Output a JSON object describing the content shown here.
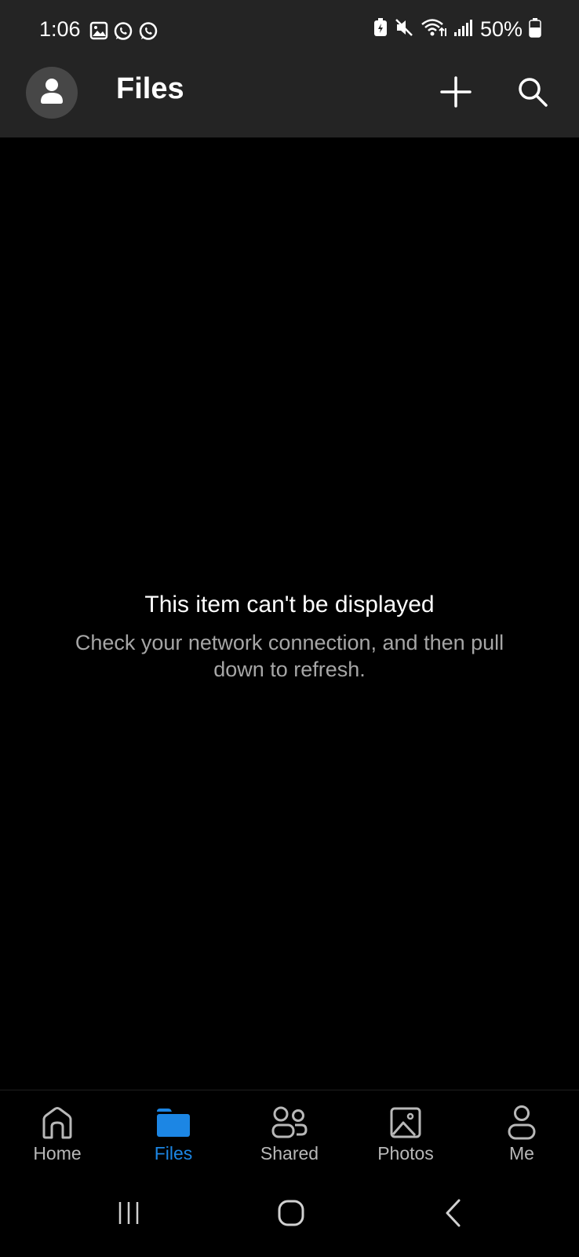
{
  "status_bar": {
    "time": "1:06",
    "battery": "50%",
    "left_icons": [
      "gallery-notification-icon",
      "whatsapp-icon",
      "whatsapp-icon"
    ],
    "right_icons": [
      "battery-saver-icon",
      "mute-icon",
      "wifi-icon",
      "signal-icon",
      "battery-icon"
    ]
  },
  "app_bar": {
    "title": "Files",
    "actions": [
      "add-icon",
      "search-icon"
    ]
  },
  "empty_state": {
    "title": "This item can't be displayed",
    "message": "Check your network connection, and then pull down to refresh."
  },
  "bottom_nav": {
    "items": [
      {
        "label": "Home",
        "icon": "home-icon",
        "active": false
      },
      {
        "label": "Files",
        "icon": "folder-icon",
        "active": true
      },
      {
        "label": "Shared",
        "icon": "people-icon",
        "active": false
      },
      {
        "label": "Photos",
        "icon": "photo-icon",
        "active": false
      },
      {
        "label": "Me",
        "icon": "person-icon",
        "active": false
      }
    ]
  },
  "system_nav": [
    "recent-apps-icon",
    "home-button-icon",
    "back-icon"
  ],
  "colors": {
    "header_bg": "#242424",
    "background": "#000000",
    "accent": "#1c86e4",
    "secondary_text": "#a6a6a6"
  }
}
